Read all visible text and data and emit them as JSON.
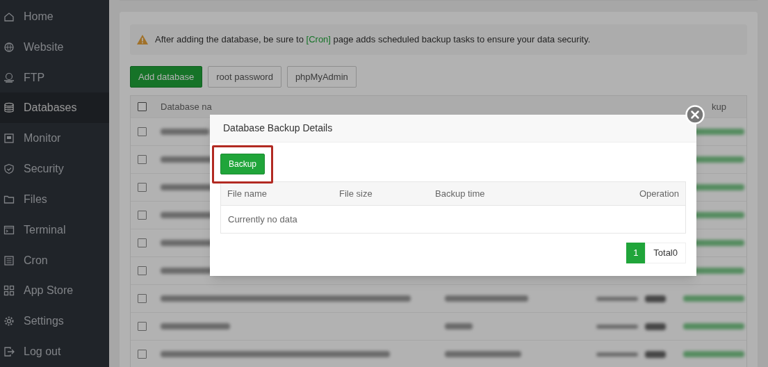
{
  "sidebar": {
    "items": [
      {
        "label": "Home",
        "selected": false
      },
      {
        "label": "Website",
        "selected": false
      },
      {
        "label": "FTP",
        "selected": false
      },
      {
        "label": "Databases",
        "selected": true
      },
      {
        "label": "Monitor",
        "selected": false
      },
      {
        "label": "Security",
        "selected": false
      },
      {
        "label": "Files",
        "selected": false
      },
      {
        "label": "Terminal",
        "selected": false
      },
      {
        "label": "Cron",
        "selected": false
      },
      {
        "label": "App Store",
        "selected": false
      },
      {
        "label": "Settings",
        "selected": false
      },
      {
        "label": "Log out",
        "selected": false
      }
    ]
  },
  "notice": {
    "text": "After adding the database, be sure to",
    "link": "[Cron]",
    "text_after": "page adds scheduled backup tasks to ensure your data security."
  },
  "toolbar": [
    {
      "label": "Add database",
      "kind": "primary"
    },
    {
      "label": "root password",
      "kind": "default"
    },
    {
      "label": "phpMyAdmin",
      "kind": "default"
    }
  ],
  "table": {
    "columns": [
      "Database na",
      "kup"
    ],
    "checked": false,
    "rows": [
      {
        "checked": false
      },
      {
        "checked": false
      },
      {
        "checked": false
      },
      {
        "checked": false
      },
      {
        "checked": false
      },
      {
        "checked": false
      },
      {
        "checked": false
      },
      {
        "checked": false
      },
      {
        "checked": false
      }
    ]
  },
  "modal": {
    "title": "Database Backup Details",
    "backup_button": "Backup",
    "highlighted": true,
    "columns": [
      "File name",
      "File size",
      "Backup time",
      "Operation"
    ],
    "empty_text": "Currently no data",
    "pagination": {
      "pages": [
        {
          "label": "1",
          "selected": true
        }
      ],
      "total": "Total0"
    }
  }
}
